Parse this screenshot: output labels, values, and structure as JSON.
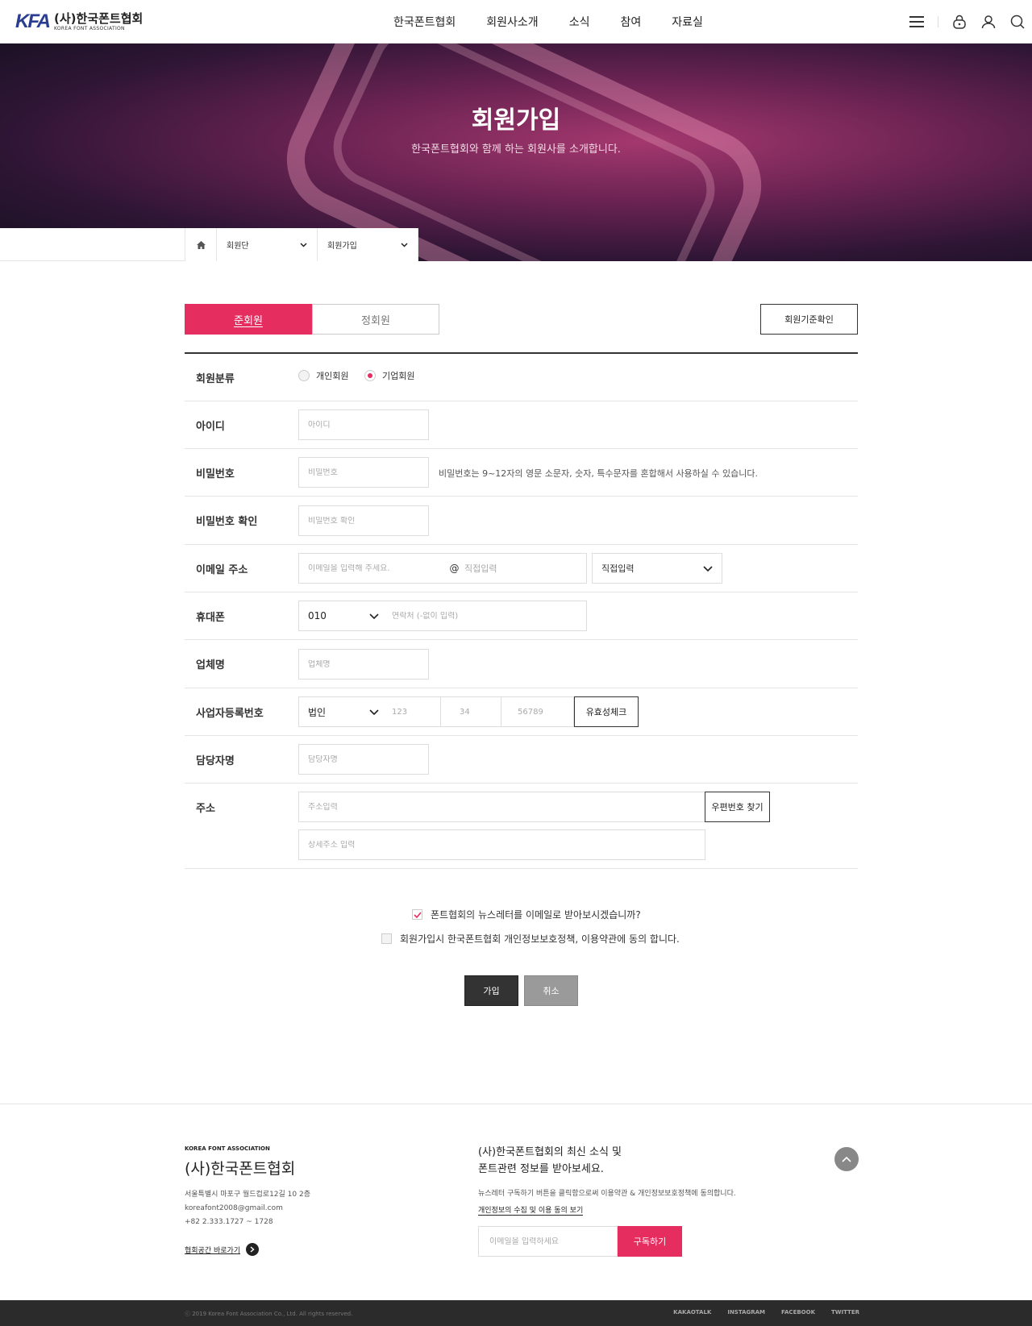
{
  "header": {
    "logo_mark": "KFA",
    "logo_title": "(사)한국폰트협회",
    "logo_sub": "KOREA FONT ASSOCIATION",
    "nav": [
      "한국폰트협회",
      "회원사소개",
      "소식",
      "참여",
      "자료실"
    ],
    "icons": [
      "menu-icon",
      "lock-icon",
      "user-icon",
      "search-icon"
    ]
  },
  "hero": {
    "title": "회원가입",
    "subtitle": "한국폰트협회와 함께 하는 회원사를 소개합니다."
  },
  "breadcrumb": {
    "home_icon": "home-icon",
    "level1": "회원단",
    "level2": "회원가입"
  },
  "tabs": {
    "active": "준회원",
    "inactive": "정회원",
    "criteria_button": "회원기준확인"
  },
  "form": {
    "member_type": {
      "label": "회원분류",
      "options": [
        "개인회원",
        "기업회원"
      ],
      "selected": "기업회원"
    },
    "id": {
      "label": "아이디",
      "placeholder": "아이디"
    },
    "password": {
      "label": "비밀번호",
      "placeholder": "비밀번호",
      "hint": "비밀번호는 9~12자의 영문 소문자, 숫자, 특수문자를 혼합해서 사용하실 수 있습니다."
    },
    "password_confirm": {
      "label": "비밀번호 확인",
      "placeholder": "비밀번호 확인"
    },
    "email": {
      "label": "이메일 주소",
      "placeholder": "이메일을 입력해 주세요.",
      "at": "@",
      "domain_placeholder": "직접입력",
      "domain_select": "직접입력"
    },
    "phone": {
      "label": "휴대폰",
      "prefix": "010",
      "placeholder": "연락처 (-없이 입력)"
    },
    "company": {
      "label": "업체명",
      "placeholder": "업체명"
    },
    "biz_number": {
      "label": "사업자등록번호",
      "type": "법인",
      "part1": "123",
      "part2": "34",
      "part3": "56789",
      "check_button": "유효성체크"
    },
    "manager": {
      "label": "담당자명",
      "placeholder": "담당자명"
    },
    "address": {
      "label": "주소",
      "placeholder": "주소입력",
      "detail_placeholder": "상세주소 입력",
      "zip_button": "우편번호 찾기"
    }
  },
  "agreements": {
    "newsletter": "폰트협회의 뉴스레터를 이메일로 받아보시겠습니까?",
    "newsletter_checked": true,
    "privacy": "회원가입시 한국폰트협회 개인정보보호정책, 이용약관에 동의 합니다.",
    "privacy_checked": false
  },
  "buttons": {
    "join": "가입",
    "cancel": "취소"
  },
  "footer": {
    "eng_name": "KOREA FONT ASSOCIATION",
    "name": "(사)한국폰트협회",
    "address": "서울특별시 마포구 월드컵로12길 10 2층",
    "email": "koreafont2008@gmail.com",
    "phone": "+82 2.333.1727 ~ 1728",
    "space_link": "협회공간 바로가기",
    "news_line1": "(사)한국폰트협회의 최신 소식 및",
    "news_line2": "폰트관련 정보를 받아보세요.",
    "news_desc": "뉴스레터 구독하기 버튼을 클릭함으로써 이용약관 & 개인정보보호정책에 동의합니다.",
    "policy_link": "개인정보의 수집 및 이용 동의 보기",
    "email_placeholder": "이메일을 입력하세요",
    "subscribe": "구독하기",
    "copyright": "ⓒ  2019 Korea Font Association Co., Ltd. All rights reserved.",
    "sns": [
      "KAKAOTALK",
      "INSTAGRAM",
      "FACEBOOK",
      "TWITTER"
    ]
  },
  "colors": {
    "accent": "#e62d5f",
    "dark": "#333333",
    "footer_bar": "#2b2b2b"
  }
}
